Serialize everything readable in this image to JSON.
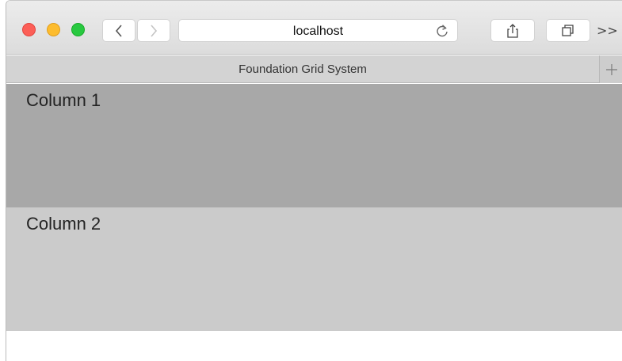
{
  "browser": {
    "address": "localhost",
    "tab_title": "Foundation Grid System",
    "icons": {
      "back": "chevron-left-icon",
      "forward": "chevron-right-icon",
      "reload": "reload-icon",
      "share": "share-icon",
      "tabs": "tabs-icon",
      "more": "double-chevron-icon",
      "new_tab": "plus-icon"
    },
    "more_label": ">>"
  },
  "page": {
    "columns": [
      {
        "label": "Column 1",
        "color": "#a8a8a8"
      },
      {
        "label": "Column 2",
        "color": "#cbcbcb"
      }
    ]
  }
}
